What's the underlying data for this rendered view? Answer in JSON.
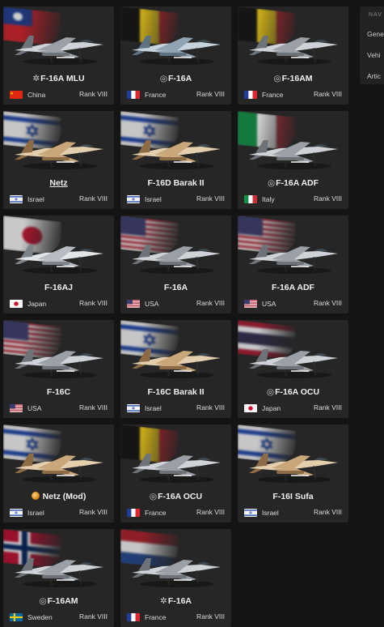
{
  "nav": {
    "header": "NAV",
    "items": [
      "Gene",
      "Vehi",
      "Artic"
    ]
  },
  "cards": [
    {
      "name": "F-16A MLU",
      "prefix": "✲",
      "nation": "China",
      "rank": "Rank VIII",
      "flag": "taiwan",
      "nation_flag": "china",
      "camo": "grey"
    },
    {
      "name": "F-16A",
      "prefix": "◎",
      "nation": "France",
      "rank": "Rank VIII",
      "flag": "belgium",
      "nation_flag": "france",
      "camo": "blue"
    },
    {
      "name": "F-16AM",
      "prefix": "◎",
      "nation": "France",
      "rank": "Rank VIII",
      "flag": "belgium",
      "nation_flag": "france",
      "camo": "grey"
    },
    {
      "name": "Netz",
      "prefix": "",
      "underlined": true,
      "nation": "Israel",
      "rank": "Rank VIII",
      "flag": "israel",
      "nation_flag": "israel",
      "camo": "desert"
    },
    {
      "name": "F-16D Barak II",
      "prefix": "",
      "nation": "Israel",
      "rank": "Rank VIII",
      "flag": "israel",
      "nation_flag": "israel",
      "camo": "desert"
    },
    {
      "name": "F-16A ADF",
      "prefix": "◎",
      "nation": "Italy",
      "rank": "Rank VIII",
      "flag": "italy",
      "nation_flag": "italy",
      "camo": "grey"
    },
    {
      "name": "F-16AJ",
      "prefix": "",
      "nation": "Japan",
      "rank": "Rank VIII",
      "flag": "japan",
      "nation_flag": "japan",
      "camo": "light"
    },
    {
      "name": "F-16A",
      "prefix": "",
      "nation": "USA",
      "rank": "Rank VIII",
      "flag": "usa",
      "nation_flag": "usa",
      "camo": "grey"
    },
    {
      "name": "F-16A ADF",
      "prefix": "",
      "nation": "USA",
      "rank": "Rank VIII",
      "flag": "usa",
      "nation_flag": "usa",
      "camo": "grey"
    },
    {
      "name": "F-16C",
      "prefix": "",
      "nation": "USA",
      "rank": "Rank VIII",
      "flag": "usa",
      "nation_flag": "usa",
      "camo": "grey"
    },
    {
      "name": "F-16C Barak II",
      "prefix": "",
      "nation": "Israel",
      "rank": "Rank VIII",
      "flag": "israel",
      "nation_flag": "israel",
      "camo": "desert"
    },
    {
      "name": "F-16A OCU",
      "prefix": "◎",
      "nation": "Japan",
      "rank": "Rank VIII",
      "flag": "thailand",
      "nation_flag": "japan",
      "camo": "grey"
    },
    {
      "name": "Netz (Mod)",
      "prefix": "",
      "medal": true,
      "nation": "Israel",
      "rank": "Rank VIII",
      "flag": "israel",
      "nation_flag": "israel",
      "camo": "desert"
    },
    {
      "name": "F-16A OCU",
      "prefix": "◎",
      "nation": "France",
      "rank": "Rank VIII",
      "flag": "belgium",
      "nation_flag": "france",
      "camo": "grey"
    },
    {
      "name": "F-16I Sufa",
      "prefix": "",
      "nation": "Israel",
      "rank": "Rank VIII",
      "flag": "israel",
      "nation_flag": "israel",
      "camo": "desert"
    },
    {
      "name": "F-16AM",
      "prefix": "◎",
      "nation": "Sweden",
      "rank": "Rank VIII",
      "flag": "norway",
      "nation_flag": "sweden",
      "camo": "grey"
    },
    {
      "name": "F-16A",
      "prefix": "✲",
      "nation": "France",
      "rank": "Rank VIII",
      "flag": "netherlands",
      "nation_flag": "france",
      "camo": "grey"
    }
  ],
  "colors": {
    "background": "#141414",
    "card": "#262626",
    "text": "#f0f0f0"
  }
}
